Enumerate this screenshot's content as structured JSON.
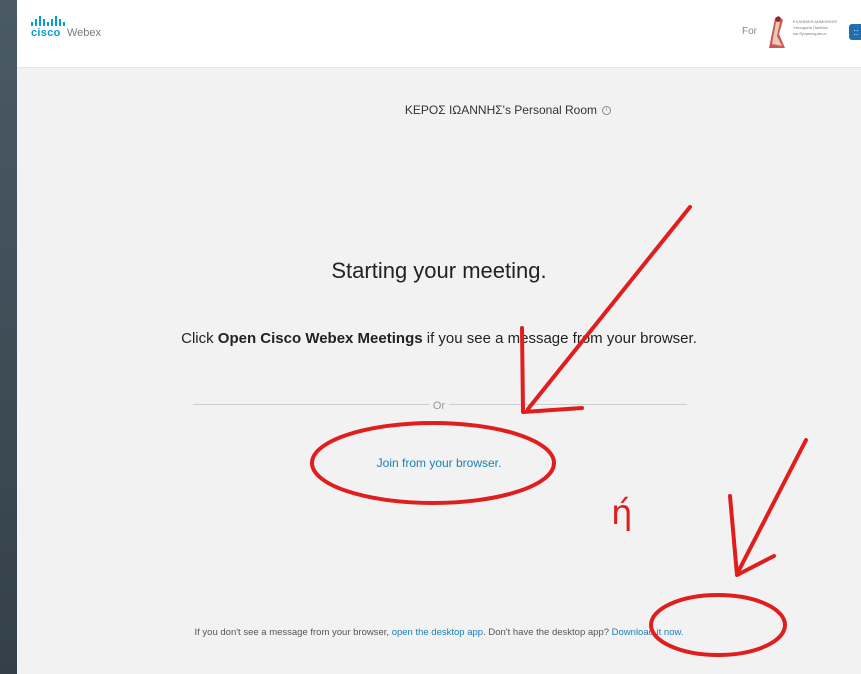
{
  "header": {
    "brand_cisco": "cisco",
    "brand_webex": "Webex",
    "for_label": "For",
    "badge_text": "::"
  },
  "org_logo_lines": [
    "ΕΛΛΗΝΙΚΗ ΔΗΜΟΚΡΑΤΙΑ",
    "Υπουργείο Παιδείας",
    "και Θρησκευμάτων"
  ],
  "main": {
    "room_title": "ΚΕΡΟΣ ΙΩΑΝΝΗΣ's Personal Room",
    "heading": "Starting your meeting.",
    "instruction_prefix": "Click ",
    "instruction_bold": "Open Cisco Webex Meetings",
    "instruction_suffix": " if you see a message from your browser.",
    "or_label": "Or",
    "join_link": "Join from your browser."
  },
  "footer": {
    "text1": "If you don't see a message from your browser, ",
    "link1": "open the desktop app",
    "text2": ". Don't have the desktop app? ",
    "link2": "Download it now."
  },
  "annotation": {
    "handwritten": "ή"
  },
  "colors": {
    "brand_blue": "#049fd9",
    "link_blue": "#1a7fb5",
    "annotation_red": "#e01e1e"
  }
}
